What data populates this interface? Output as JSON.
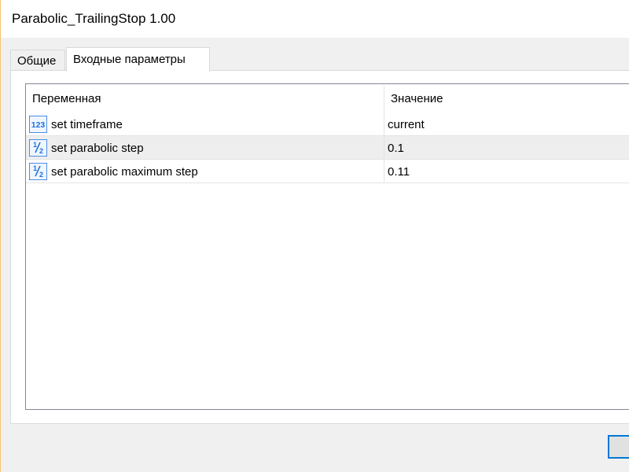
{
  "window": {
    "title": "Parabolic_TrailingStop 1.00"
  },
  "tabs": [
    {
      "label": "Общие",
      "active": false
    },
    {
      "label": "Входные параметры",
      "active": true
    }
  ],
  "grid": {
    "columns": {
      "variable": "Переменная",
      "value": "Значение"
    },
    "rows": [
      {
        "icon": "integer-123-icon",
        "name": "set timeframe",
        "value": "current"
      },
      {
        "icon": "fraction-half-icon",
        "name": "set parabolic step",
        "value": "0.1"
      },
      {
        "icon": "fraction-half-icon",
        "name": "set parabolic maximum step",
        "value": "0.11"
      }
    ]
  },
  "colors": {
    "accent": "#0078d7",
    "icon_blue": "#1e6fd9",
    "selected_row": "#eeeeee"
  }
}
